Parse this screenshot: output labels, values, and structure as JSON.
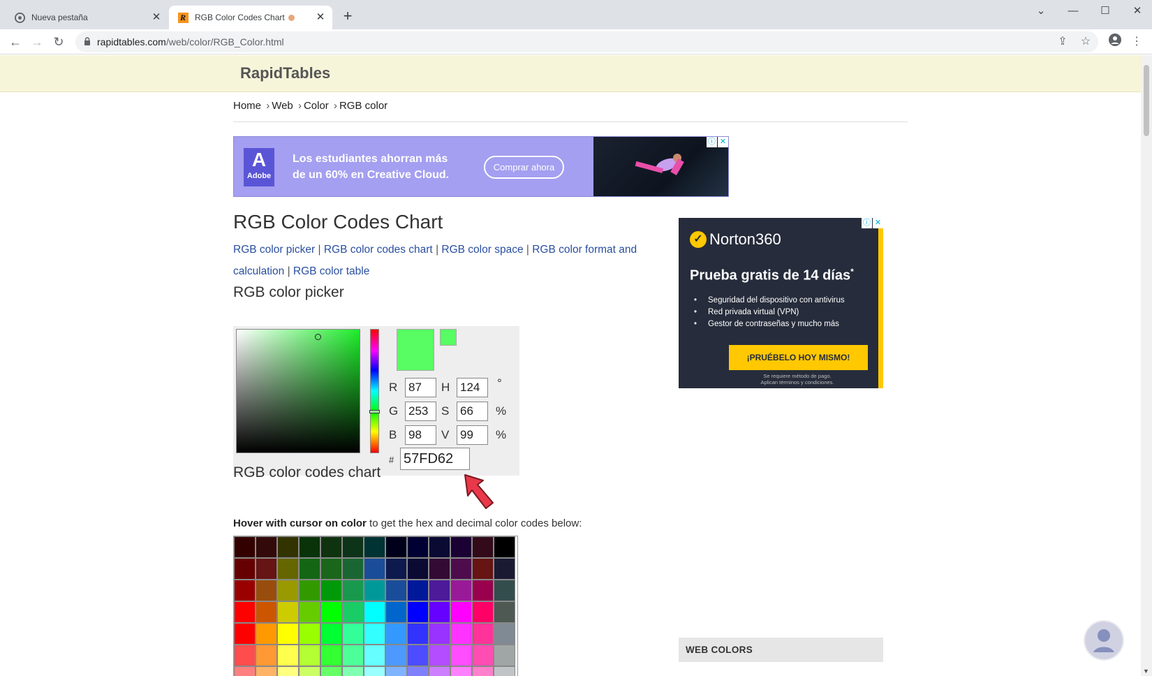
{
  "browser": {
    "tabs": [
      {
        "title": "Nueva pestaña",
        "active": false
      },
      {
        "title": "RGB Color Codes Chart",
        "active": true
      }
    ],
    "url_host": "rapidtables.com",
    "url_path": "/web/color/RGB_Color.html"
  },
  "site": {
    "logo": "RapidTables"
  },
  "breadcrumb": {
    "home": "Home",
    "web": "Web",
    "color": "Color",
    "current": "RGB color",
    "separator": "›"
  },
  "ad_adobe": {
    "brand": "Adobe",
    "text_line1": "Los estudiantes ahorran más",
    "text_line2": "de un 60% en Creative Cloud.",
    "button": "Comprar ahora"
  },
  "ad_norton": {
    "brand": "Norton360",
    "headline": "Prueba gratis de 14 días",
    "asterisk": "*",
    "bullets": [
      "Seguridad del dispositivo con antivirus",
      "Red privada virtual (VPN)",
      "Gestor de contraseñas y mucho más"
    ],
    "button": "¡PRUÉBELO HOY MISMO!",
    "fineprint_1": "Se requiere método de pago.",
    "fineprint_2": "Aplican términos y condiciones."
  },
  "page": {
    "title": "RGB Color Codes Chart",
    "links": [
      "RGB color picker",
      "RGB color codes chart",
      "RGB color space",
      "RGB color format and calculation",
      "RGB color table"
    ],
    "link_separator": "|",
    "section_picker": "RGB color picker",
    "section_chart": "RGB color codes chart",
    "hover_bold": "Hover with cursor on color",
    "hover_rest": " to get the hex and decimal color codes below:",
    "side_heading": "WEB COLORS"
  },
  "picker": {
    "labels": {
      "r": "R",
      "g": "G",
      "b": "B",
      "h": "H",
      "s": "S",
      "v": "V",
      "deg": "°",
      "pct1": "%",
      "pct2": "%",
      "hash": "#"
    },
    "r": "87",
    "g": "253",
    "b": "98",
    "h": "124",
    "s": "66",
    "v": "99",
    "hex": "57FD62",
    "selected_color": "#57FD62"
  },
  "color_chart": [
    [
      "#330000",
      "#330a0a",
      "#333300",
      "#0a330a",
      "#0f330f",
      "#0d3319",
      "#003333",
      "#00001a",
      "#000033",
      "#0a0a33",
      "#1a0033",
      "#330a1a",
      "#000000"
    ],
    [
      "#660000",
      "#661414",
      "#666600",
      "#146614",
      "#1a661a",
      "#1a6633",
      "#1a4d99",
      "#0d1a4d",
      "#0a0a33",
      "#330a33",
      "#4d0d4d",
      "#661414",
      "#1a1a33"
    ],
    [
      "#990000",
      "#994d0d",
      "#999900",
      "#339900",
      "#00990a",
      "#19994d",
      "#009999",
      "#1a4d99",
      "#00199a",
      "#4d1a99",
      "#991a99",
      "#99004d",
      "#334d4d"
    ],
    [
      "#ff0000",
      "#cc5500",
      "#cccc00",
      "#66cc00",
      "#00ff00",
      "#19cc66",
      "#00ffff",
      "#0066cc",
      "#0000ff",
      "#6600ff",
      "#ff00ff",
      "#ff0066",
      "#4d5952"
    ],
    [
      "#ff0000",
      "#ff9900",
      "#ffff00",
      "#99ff00",
      "#00ff33",
      "#33ff99",
      "#33ffff",
      "#3399ff",
      "#3333ff",
      "#9933ff",
      "#ff33ff",
      "#ff3399",
      "#808a94"
    ],
    [
      "#ff4d4d",
      "#ff9933",
      "#ffff4d",
      "#b3ff33",
      "#33ff33",
      "#4dff99",
      "#66ffff",
      "#4d99ff",
      "#4d4dff",
      "#b34dff",
      "#ff4dff",
      "#ff4db3",
      "#a0a6a6"
    ],
    [
      "#ff8080",
      "#ffb366",
      "#ffff80",
      "#ccff66",
      "#66ff66",
      "#80ffb3",
      "#99ffff",
      "#80b3ff",
      "#8080ff",
      "#cc80ff",
      "#ff80ff",
      "#ff80cc",
      "#c0c4c6"
    ]
  ]
}
